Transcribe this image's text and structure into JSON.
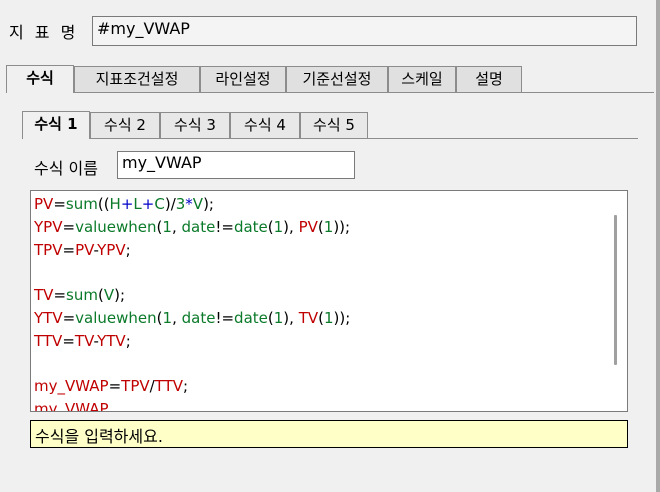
{
  "indicator": {
    "label": "지 표 명",
    "value": "#my_VWAP"
  },
  "main_tabs": [
    {
      "label": "수식",
      "active": true
    },
    {
      "label": "지표조건설정",
      "active": false
    },
    {
      "label": "라인설정",
      "active": false
    },
    {
      "label": "기준선설정",
      "active": false
    },
    {
      "label": "스케일",
      "active": false
    },
    {
      "label": "설명",
      "active": false
    }
  ],
  "sub_tabs": [
    {
      "label": "수식 1",
      "active": true
    },
    {
      "label": "수식 2",
      "active": false
    },
    {
      "label": "수식 3",
      "active": false
    },
    {
      "label": "수식 4",
      "active": false
    },
    {
      "label": "수식 5",
      "active": false
    }
  ],
  "formula": {
    "name_label": "수식 이름",
    "name_value": "my_VWAP",
    "lines": [
      "PV=sum((H+L+C)/3*V);",
      "YPV=valuewhen(1, date!=date(1), PV(1));",
      "TPV=PV-YPV;",
      "",
      "TV=sum(V);",
      "YTV=valuewhen(1, date!=date(1), TV(1));",
      "TTV=TV-YTV;",
      "",
      "my_VWAP=TPV/TTV;",
      "my_VWAP"
    ]
  },
  "hint": "수식을 입력하세요.",
  "colors": {
    "variable": "#c00000",
    "function": "#0b7a2a",
    "price_field": "#0000c8",
    "hint_bg": "#ffffc8"
  }
}
